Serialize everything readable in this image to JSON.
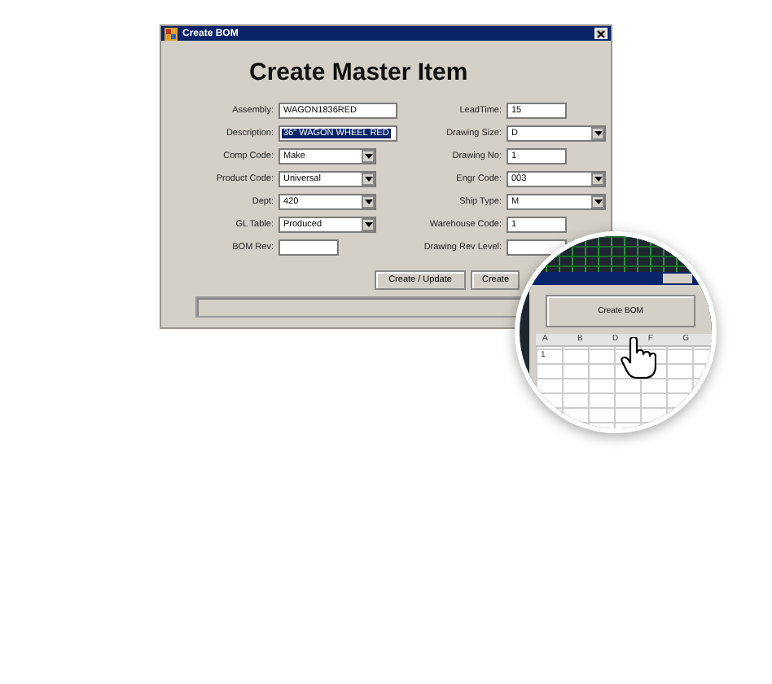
{
  "window": {
    "title": "Create BOM"
  },
  "heading": "Create Master Item",
  "left_fields": [
    {
      "label": "Assembly:",
      "kind": "text",
      "value": "WAGON1836RED",
      "selected": false
    },
    {
      "label": "Description:",
      "kind": "text",
      "value": "36\" WAGON WHEEL RED",
      "selected": true
    },
    {
      "label": "Comp Code:",
      "kind": "select",
      "value": "Make"
    },
    {
      "label": "Product Code:",
      "kind": "select",
      "value": "Universal"
    },
    {
      "label": "Dept:",
      "kind": "select",
      "value": "420"
    },
    {
      "label": "GL Table:",
      "kind": "select",
      "value": "Produced"
    },
    {
      "label": "BOM Rev:",
      "kind": "short"
    }
  ],
  "right_fields": [
    {
      "label": "LeadTime:",
      "kind": "short",
      "value": "15"
    },
    {
      "label": "Drawing Size:",
      "kind": "select",
      "value": "D"
    },
    {
      "label": "Drawing No:",
      "kind": "short",
      "value": "1"
    },
    {
      "label": "Engr Code:",
      "kind": "select",
      "value": "003"
    },
    {
      "label": "Ship Type:",
      "kind": "select",
      "value": "M"
    },
    {
      "label": "Warehouse Code:",
      "kind": "short",
      "value": "1"
    },
    {
      "label": "Drawing Rev Level:",
      "kind": "short"
    }
  ],
  "progress": {
    "level": 0
  },
  "buttons": [
    "Create / Update",
    "Create"
  ],
  "magnifier": {
    "button": "Create BOM",
    "columns": [
      "A",
      "B",
      "D",
      "F",
      "G"
    ],
    "row": "1"
  }
}
